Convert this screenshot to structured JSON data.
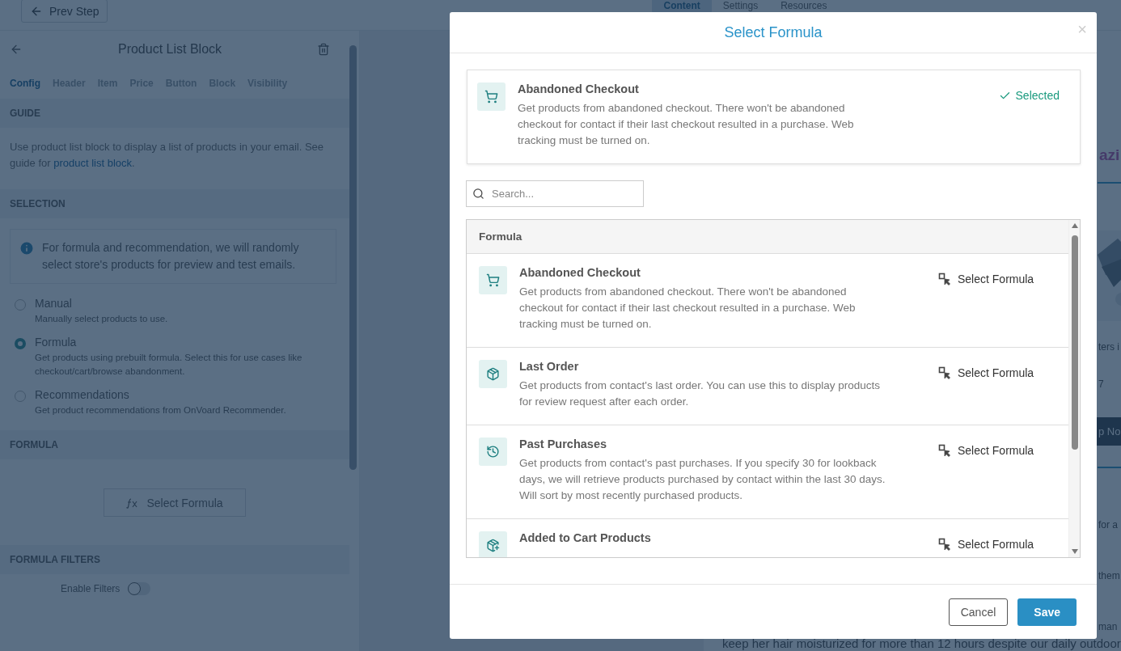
{
  "top_bar": {
    "back_button": "Prev Step",
    "tabs": [
      {
        "label": "Content",
        "selected": true
      },
      {
        "label": "Settings",
        "selected": false
      },
      {
        "label": "Resources",
        "selected": false
      }
    ]
  },
  "sidebar": {
    "title": "Product List Block",
    "tabs": [
      {
        "label": "Config",
        "selected": true
      },
      {
        "label": "Header",
        "selected": false
      },
      {
        "label": "Item",
        "selected": false
      },
      {
        "label": "Price",
        "selected": false
      },
      {
        "label": "Button",
        "selected": false
      },
      {
        "label": "Block",
        "selected": false
      },
      {
        "label": "Visibility",
        "selected": false
      }
    ],
    "guide": {
      "heading": "GUIDE",
      "text": "Use product list block to display a list of products in your email. See guide for ",
      "link": "product list block",
      "text_end": "."
    },
    "selection": {
      "heading": "SELECTION",
      "info": "For formula and recommendation, we will randomly select store's products for preview and test emails.",
      "options": [
        {
          "label": "Manual",
          "description": "Manually select products to use.",
          "selected": false
        },
        {
          "label": "Formula",
          "description": "Get products using prebuilt formula. Select this for use cases like checkout/cart/browse abandonment.",
          "selected": true
        },
        {
          "label": "Recommendations",
          "description": "Get product recommendations from OnVoard Recommender.",
          "selected": false
        }
      ]
    },
    "formula": {
      "heading": "FORMULA",
      "button": "Select Formula"
    },
    "filters": {
      "heading": "FORMULA FILTERS",
      "toggle": {
        "label": "Enable Filters",
        "on": false
      }
    }
  },
  "preview": {
    "items": [
      {
        "kind": "heading",
        "text": "azi"
      },
      {
        "kind": "rule"
      },
      {
        "kind": "picture"
      },
      {
        "kind": "text",
        "text": "ters i"
      },
      {
        "kind": "text",
        "text": "7"
      },
      {
        "kind": "button",
        "text": "p No"
      },
      {
        "kind": "rule"
      },
      {
        "kind": "text",
        "text": "for a"
      },
      {
        "kind": "text",
        "text": "them"
      },
      {
        "kind": "text",
        "text": "man"
      },
      {
        "kind": "wide",
        "text": "keep her hair moisturized for more than 12 hours despite our daily outdoor"
      }
    ]
  },
  "modal": {
    "title": "Select Formula",
    "close": "×",
    "current": {
      "kind": "cart",
      "title": "Abandoned Checkout",
      "description": "Get products from abandoned checkout. There won't be abandoned checkout for contact if their last checkout resulted in a purchase. Web tracking must be turned on.",
      "status": "Selected"
    },
    "search": {
      "placeholder": "Search..."
    },
    "list": {
      "header": "Formula",
      "items": [
        {
          "kind": "cart",
          "title": "Abandoned Checkout",
          "description": "Get products from abandoned checkout. There won't be abandoned checkout for contact if their last checkout resulted in a purchase. Web tracking must be turned on.",
          "action": "Select Formula"
        },
        {
          "kind": "box",
          "title": "Last Order",
          "description": "Get products from contact's last order. You can use this to display products for review request after each order.",
          "action": "Select Formula"
        },
        {
          "kind": "history",
          "title": "Past Purchases",
          "description": "Get products from contact's past purchases. If you specify 30 for lookback days, we will retrieve products purchased by contact within the last 30 days. Will sort by most recently purchased products.",
          "action": "Select Formula"
        },
        {
          "kind": "box-plus",
          "title": "Added to Cart Products",
          "action": "Select Formula"
        }
      ]
    },
    "buttons": {
      "cancel": "Cancel",
      "save": "Save"
    }
  }
}
